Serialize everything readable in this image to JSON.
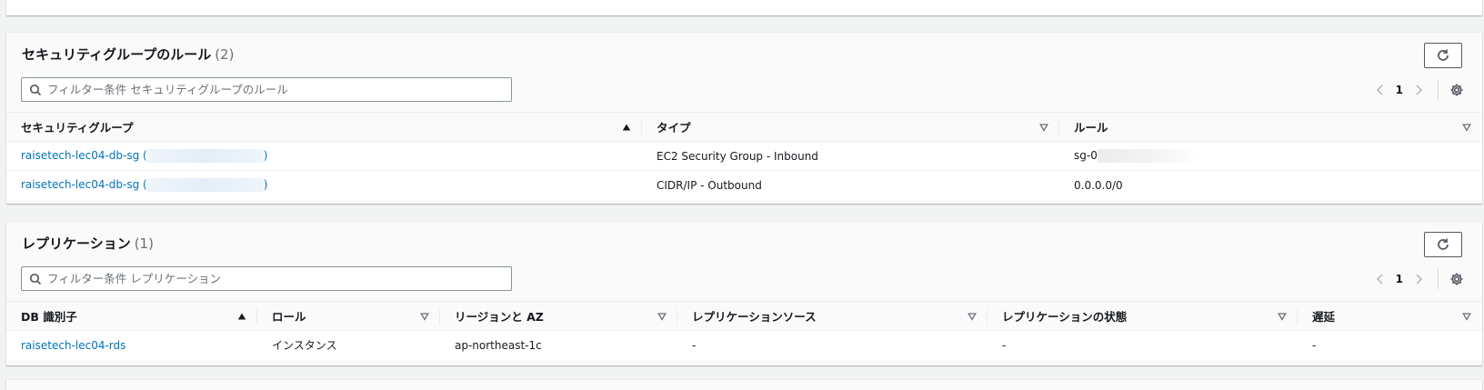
{
  "security_groups": {
    "title": "セキュリティグループのルール",
    "count": "(2)",
    "filter_placeholder": "フィルター条件 セキュリティグループのルール",
    "page": "1",
    "columns": [
      "セキュリティグループ",
      "タイプ",
      "ルール"
    ],
    "rows": [
      {
        "group_prefix": "raisetech-lec04-db-sg (",
        "group_suffix": ")",
        "type": "EC2 Security Group - Inbound",
        "rule": "sg-0"
      },
      {
        "group_prefix": "raisetech-lec04-db-sg (",
        "group_suffix": ")",
        "type": "CIDR/IP - Outbound",
        "rule": "0.0.0.0/0"
      }
    ]
  },
  "replication": {
    "title": "レプリケーション",
    "count": "(1)",
    "filter_placeholder": "フィルター条件 レプリケーション",
    "page": "1",
    "columns": [
      "DB 識別子",
      "ロール",
      "リージョンと AZ",
      "レプリケーションソース",
      "レプリケーションの状態",
      "遅延"
    ],
    "rows": [
      {
        "db_id": "raisetech-lec04-rds",
        "role": "インスタンス",
        "region_az": "ap-northeast-1c",
        "source": "-",
        "status": "-",
        "lag": "-"
      }
    ]
  },
  "colors": {
    "link": "#0073bb",
    "background": "#f2f3f3",
    "border": "#eaeded"
  },
  "icons": [
    "refresh-icon",
    "search-icon",
    "chevron-left-icon",
    "chevron-right-icon",
    "settings-gear-icon",
    "sort-ascending-icon",
    "sort-descending-icon"
  ]
}
